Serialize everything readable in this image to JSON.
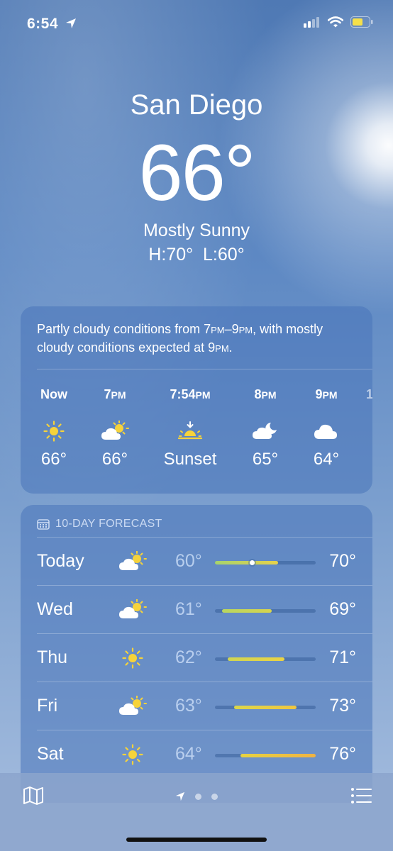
{
  "status": {
    "time": "6:54"
  },
  "hero": {
    "city": "San Diego",
    "temperature": "66°",
    "condition": "Mostly Sunny",
    "high_low": "H:70°  L:60°"
  },
  "hourly": {
    "summary_parts": [
      "Partly cloudy conditions from 7",
      "PM",
      "–9",
      "PM",
      ", with mostly cloudy conditions expected at 9",
      "PM",
      "."
    ],
    "items": [
      {
        "time": "Now",
        "suffix": "",
        "icon": "sun-icon",
        "temp": "66°"
      },
      {
        "time": "7",
        "suffix": "PM",
        "icon": "partly-cloudy-icon",
        "temp": "66°"
      },
      {
        "time": "7:54",
        "suffix": "PM",
        "icon": "sunset-icon",
        "temp": "Sunset"
      },
      {
        "time": "8",
        "suffix": "PM",
        "icon": "cloudy-night-icon",
        "temp": "65°"
      },
      {
        "time": "9",
        "suffix": "PM",
        "icon": "cloud-icon",
        "temp": "64°"
      }
    ]
  },
  "forecast": {
    "header": "10-DAY FORECAST",
    "days": [
      {
        "day": "Today",
        "icon": "partly-cloudy-icon",
        "low": "60°",
        "high": "70°",
        "bar_start": 0.0,
        "bar_end": 0.63,
        "current": 0.37,
        "colors": [
          "#a6d36d",
          "#e7d24a"
        ]
      },
      {
        "day": "Wed",
        "icon": "partly-cloudy-icon",
        "low": "61°",
        "high": "69°",
        "bar_start": 0.07,
        "bar_end": 0.56,
        "colors": [
          "#b8d660",
          "#d7d44e"
        ]
      },
      {
        "day": "Thu",
        "icon": "sun-icon",
        "low": "62°",
        "high": "71°",
        "bar_start": 0.13,
        "bar_end": 0.69,
        "colors": [
          "#cfd553",
          "#ebd344"
        ]
      },
      {
        "day": "Fri",
        "icon": "partly-cloudy-icon",
        "low": "63°",
        "high": "73°",
        "bar_start": 0.19,
        "bar_end": 0.81,
        "colors": [
          "#dbd64a",
          "#efc640"
        ]
      },
      {
        "day": "Sat",
        "icon": "sun-icon",
        "low": "64°",
        "high": "76°",
        "bar_start": 0.25,
        "bar_end": 1.0,
        "colors": [
          "#e6d341",
          "#f0b342"
        ]
      }
    ]
  },
  "colors": {
    "sun": "#f6d33b",
    "cloud": "#ffffff",
    "battery": "#f5e04a"
  }
}
